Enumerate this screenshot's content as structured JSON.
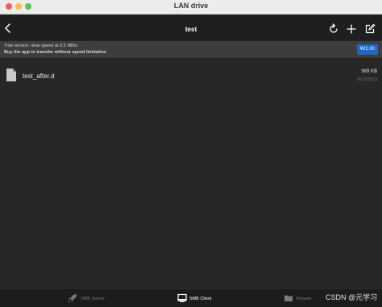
{
  "window": {
    "title": "LAN drive"
  },
  "navbar": {
    "title": "test",
    "icons": [
      "back-icon",
      "refresh-icon",
      "add-icon",
      "edit-icon"
    ]
  },
  "banner": {
    "line1": "Trial version: slow speed at 0.5 MB/s",
    "line2": "Buy the app to transfer without speed limitation",
    "price": "¥22.00",
    "price_color": "#1e66c9"
  },
  "files": [
    {
      "name": "test_after.d",
      "size": "989 KB",
      "date": "06/10/2023",
      "icon": "file-icon"
    }
  ],
  "tabs": [
    {
      "label": "SMB Server",
      "icon": "rocket-icon",
      "active": false
    },
    {
      "label": "SMB Client",
      "icon": "monitor-icon",
      "active": true
    },
    {
      "label": "Browse",
      "icon": "folder-icon",
      "active": false
    }
  ],
  "watermark": "CSDN @元学习"
}
